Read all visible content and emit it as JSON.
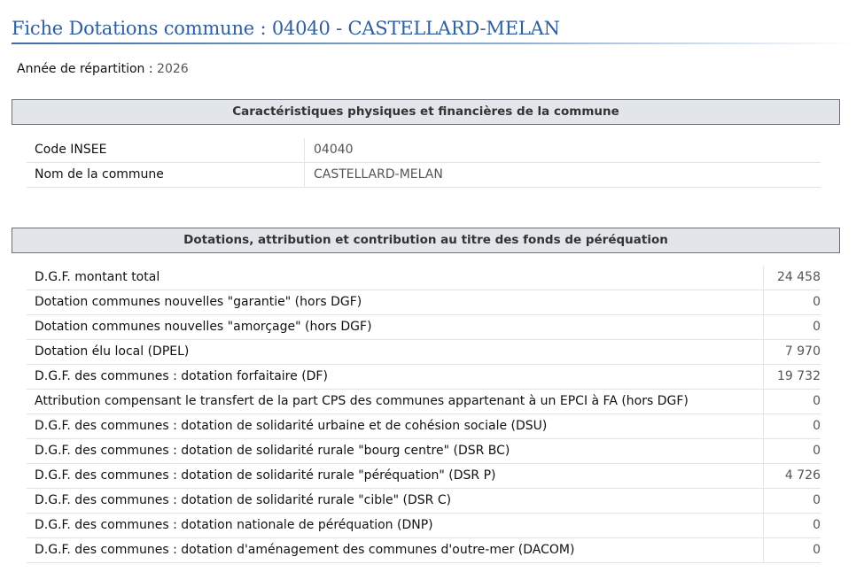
{
  "page": {
    "title": "Fiche Dotations commune : 04040 - CASTELLARD-MELAN"
  },
  "year": {
    "label": "Année de répartition : ",
    "value": "2026"
  },
  "section1": {
    "title": "Caractéristiques physiques et financières de la commune",
    "rows": [
      {
        "label": "Code INSEE",
        "value": "04040"
      },
      {
        "label": "Nom de la commune",
        "value": "CASTELLARD-MELAN"
      }
    ]
  },
  "section2": {
    "title": "Dotations, attribution et contribution au titre des fonds de péréquation",
    "rows": [
      {
        "label": "D.G.F. montant total",
        "value": "24 458"
      },
      {
        "label": "Dotation communes nouvelles \"garantie\" (hors DGF)",
        "value": "0"
      },
      {
        "label": "Dotation communes nouvelles \"amorçage\" (hors DGF)",
        "value": "0"
      },
      {
        "label": "Dotation élu local (DPEL)",
        "value": "7 970"
      },
      {
        "label": "D.G.F. des communes : dotation forfaitaire (DF)",
        "value": "19 732"
      },
      {
        "label": "Attribution compensant le transfert de la part CPS des communes appartenant à un EPCI à FA (hors DGF)",
        "value": "0"
      },
      {
        "label": "D.G.F. des communes : dotation de solidarité urbaine et de cohésion sociale (DSU)",
        "value": "0"
      },
      {
        "label": "D.G.F. des communes : dotation de solidarité rurale \"bourg centre\" (DSR BC)",
        "value": "0"
      },
      {
        "label": "D.G.F. des communes : dotation de solidarité rurale \"péréquation\" (DSR P)",
        "value": "4 726"
      },
      {
        "label": "D.G.F. des communes : dotation de solidarité rurale \"cible\" (DSR C)",
        "value": "0"
      },
      {
        "label": "D.G.F. des communes : dotation nationale de péréquation (DNP)",
        "value": "0"
      },
      {
        "label": "D.G.F. des communes : dotation d'aménagement des communes d'outre-mer (DACOM)",
        "value": "0"
      }
    ]
  }
}
